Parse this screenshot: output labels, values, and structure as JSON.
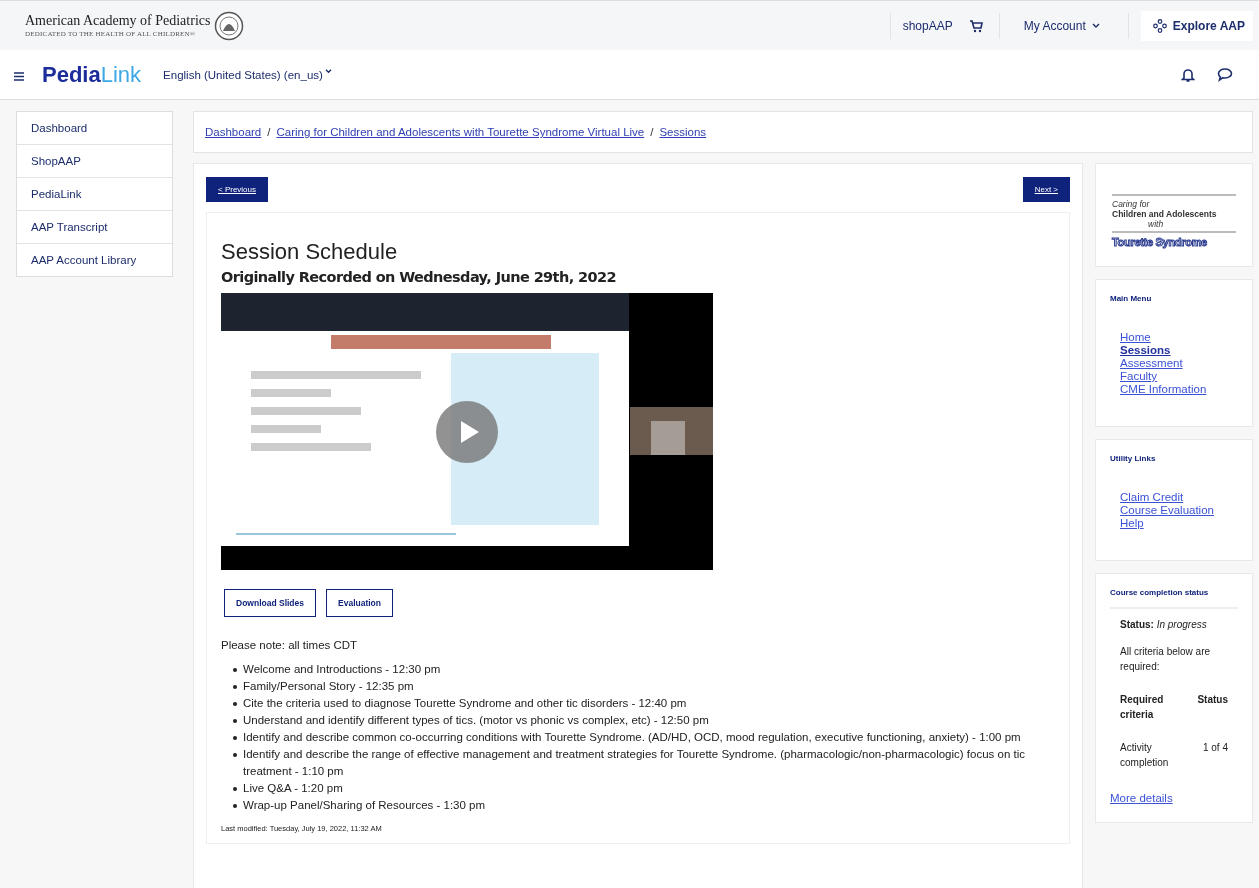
{
  "header": {
    "org_name": "American Academy of Pediatrics",
    "org_tagline": "DEDICATED TO THE HEALTH OF ALL CHILDREN®",
    "links": [
      "shopAAP"
    ],
    "account": "My Account",
    "explore": "Explore AAP"
  },
  "navbar": {
    "brand_bold": "Pedia",
    "brand_light": "Link",
    "language": "English (United States) (en_us)"
  },
  "sidebar": {
    "items": [
      {
        "label": "Dashboard"
      },
      {
        "label": "ShopAAP"
      },
      {
        "label": "PediaLink"
      },
      {
        "label": "AAP Transcript"
      },
      {
        "label": "AAP Account Library"
      }
    ]
  },
  "breadcrumb": {
    "separator": "/",
    "items": [
      "Dashboard",
      "Caring for Children and Adolescents with Tourette Syndrome Virtual Live",
      "Sessions"
    ]
  },
  "pager": {
    "previous": "< Previous",
    "next": "Next >"
  },
  "content": {
    "title": "Session Schedule",
    "subtitle": "Originally Recorded on Wednesday, June 29th, 2022",
    "video": {
      "kind": "picture"
    },
    "buttons": [
      "Download Slides",
      "Evaluation"
    ],
    "note": "Please note: all times CDT",
    "schedule": [
      "Welcome and Introductions - 12:30 pm",
      "Family/Personal Story - 12:35 pm",
      "Cite the criteria used to diagnose Tourette Syndrome and other tic disorders  - 12:40 pm",
      "Understand and identify different types of tics. (motor vs phonic vs complex, etc) - 12:50 pm",
      "Identify and describe common co-occurring conditions with Tourette Syndrome. (AD/HD, OCD, mood regulation, executive functioning, anxiety)  - 1:00 pm",
      "Identify and describe the range of effective management and treatment strategies for Tourette Syndrome. (pharmacologic/non-pharmacologic) focus on tic treatment  - 1:10 pm",
      "Live Q&A - 1:20 pm",
      "Wrap-up Panel/Sharing of Resources - 1:30 pm"
    ],
    "last_modified": "Last modified: Tuesday, July 19, 2022, 11:32 AM"
  },
  "course_logo": {
    "line_1": "Caring for",
    "line_2": "Children and Adolescents",
    "line_3": "with",
    "line_4": "Tourette Syndrome"
  },
  "main_menu": {
    "title": "Main Menu",
    "items": [
      {
        "label": "Home",
        "selected": false
      },
      {
        "label": "Sessions",
        "selected": true
      },
      {
        "label": "Assessment",
        "selected": false
      },
      {
        "label": "Faculty",
        "selected": false
      },
      {
        "label": "CME Information",
        "selected": false
      }
    ]
  },
  "utility_links": {
    "title": "Utility Links",
    "items": [
      "Claim Credit",
      "Course Evaluation",
      "Help"
    ]
  },
  "completion": {
    "title": "Course completion status",
    "status_label": "Status:",
    "status_value": "In progress",
    "note": "All criteria below are required:",
    "col_criteria": "Required criteria",
    "col_status": "Status",
    "rows": [
      {
        "criteria": "Activity completion",
        "status": "1 of 4"
      }
    ],
    "more": "More details"
  }
}
